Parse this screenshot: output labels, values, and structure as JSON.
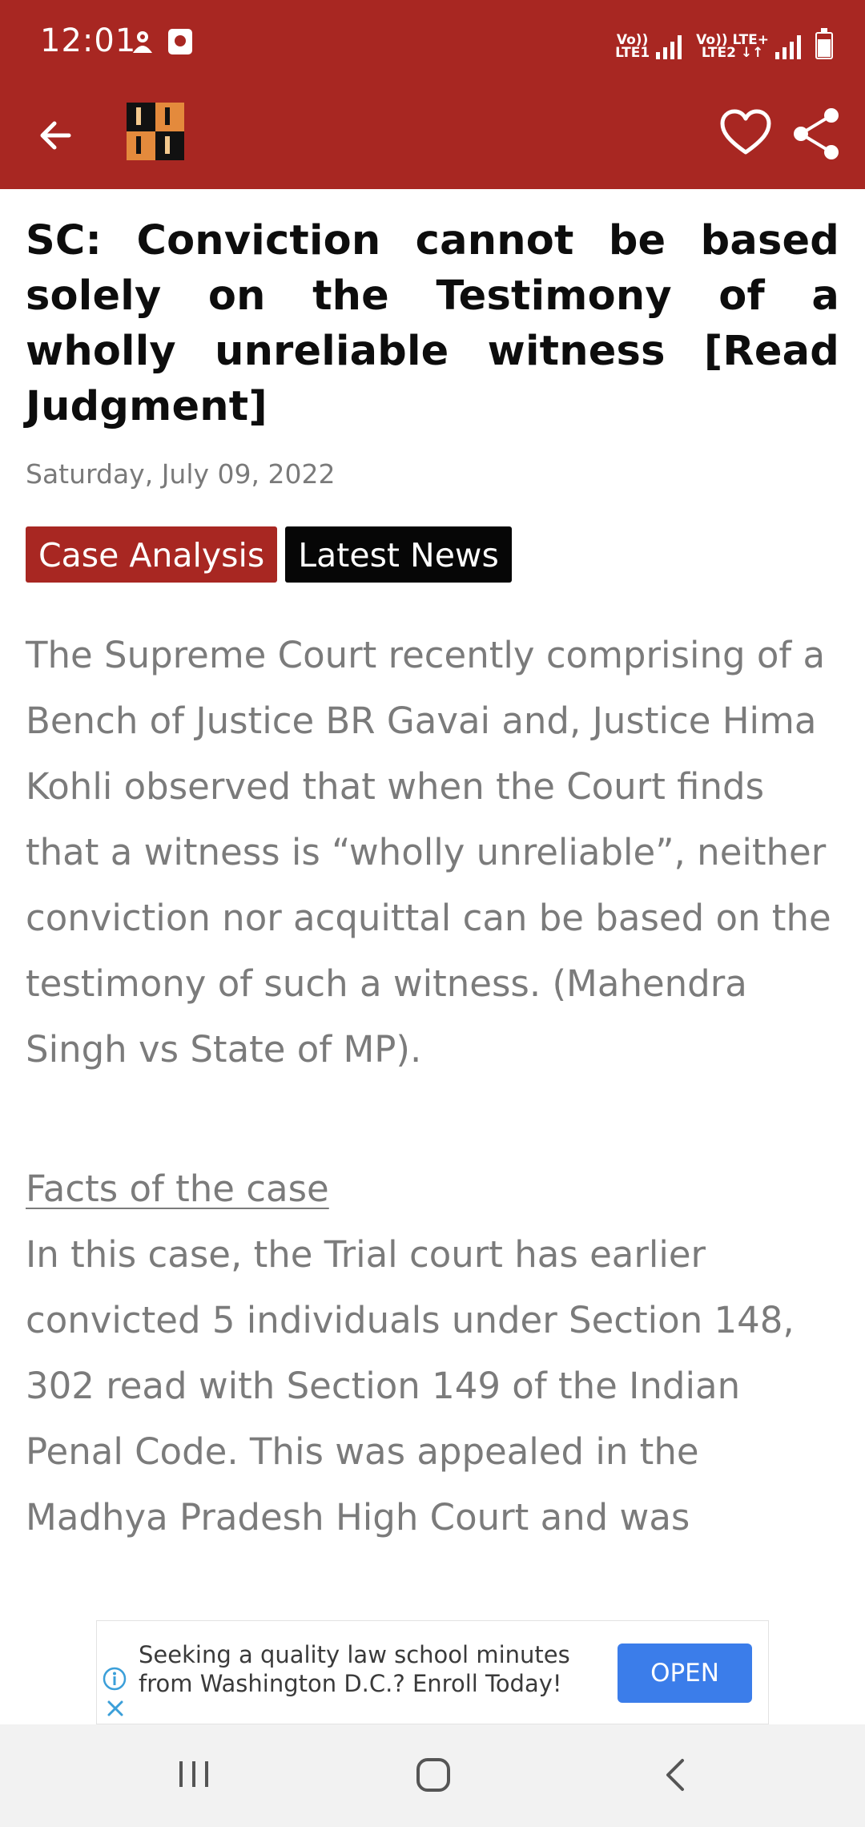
{
  "status_bar": {
    "time": "12:01",
    "sim1_label_top": "Vo))",
    "sim1_label_bottom": "LTE1",
    "sim2_label_top": "Vo)) LTE+",
    "sim2_label_bottom": "LTE2 ↓↑",
    "icons": [
      "notification-icon",
      "app-icon",
      "signal-icon",
      "battery-icon"
    ]
  },
  "toolbar": {
    "icons": [
      "back-arrow-icon",
      "site-logo",
      "heart-icon",
      "share-icon"
    ]
  },
  "article": {
    "title": "SC: Conviction cannot be based solely on the Testimony of a wholly unreliable witness [Read Judgment]",
    "date": "Saturday, July 09, 2022",
    "tags": [
      "Case Analysis",
      "Latest News"
    ],
    "paragraph1": "The Supreme Court recently comprising of a Bench of Justice BR Gavai and, Justice Hima Kohli observed that when the Court finds that a witness is “wholly unreliable”, neither conviction nor acquittal can be based on the testimony of such a witness. (Mahendra Singh vs State of MP).",
    "section_heading": "Facts of the case",
    "paragraph2": "In this case, the Trial court has earlier convicted 5 individuals under Section 148, 302 read with Section 149 of the Indian Penal Code.  This was appealed in the Madhya Pradesh High Court and was"
  },
  "ad": {
    "text": "Seeking a quality law school minutes from Washington D.C.? Enroll Today!",
    "button_label": "OPEN"
  },
  "colors": {
    "brand": "#a82722",
    "ad_button": "#3b7dea",
    "body_text": "#7b7b7b"
  }
}
